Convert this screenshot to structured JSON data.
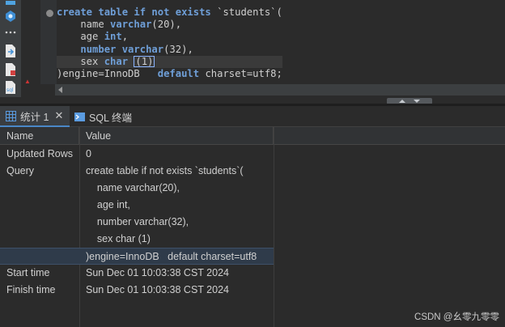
{
  "editor": {
    "lines": [
      [
        {
          "t": "create table if not exists",
          "k": true
        },
        {
          "t": " `students`(",
          "k": false
        }
      ],
      [
        {
          "t": "    name ",
          "k": false
        },
        {
          "t": "varchar",
          "k": true
        },
        {
          "t": "(20),",
          "k": false
        }
      ],
      [
        {
          "t": "    age ",
          "k": false
        },
        {
          "t": "int",
          "k": true
        },
        {
          "t": ",",
          "k": false
        }
      ],
      [
        {
          "t": "    ",
          "k": false
        },
        {
          "t": "number varchar",
          "k": true
        },
        {
          "t": "(32),",
          "k": false
        }
      ],
      [
        {
          "t": "    sex ",
          "k": false
        },
        {
          "t": "char",
          "k": true
        },
        {
          "t": " (1)",
          "k": false
        }
      ],
      [
        {
          "t": ")engine=InnoDB   ",
          "k": false
        },
        {
          "t": "default",
          "k": true
        },
        {
          "t": " charset=utf8;",
          "k": false
        }
      ]
    ]
  },
  "tabs": {
    "stats_label": "统计 1",
    "stats_close": "✕",
    "sql_label": "SQL 终端"
  },
  "grid": {
    "headers": {
      "name": "Name",
      "value": "Value"
    },
    "rows": {
      "updated_rows": {
        "name": "Updated Rows",
        "value": "0"
      },
      "query": {
        "name": "Query",
        "lines": [
          "create table if not exists `students`(",
          "    name varchar(20),",
          "    age int,",
          "    number varchar(32),",
          "    sex char (1)",
          ")engine=InnoDB   default charset=utf8"
        ]
      },
      "start_time": {
        "name": "Start time",
        "value": "Sun Dec 01 10:03:38 CST 2024"
      },
      "finish_time": {
        "name": "Finish time",
        "value": "Sun Dec 01 10:03:38 CST 2024"
      }
    }
  },
  "watermark": "CSDN @幺零九零零",
  "colors": {
    "keyword": "#6f9fd8",
    "accent": "#4a88c7"
  }
}
